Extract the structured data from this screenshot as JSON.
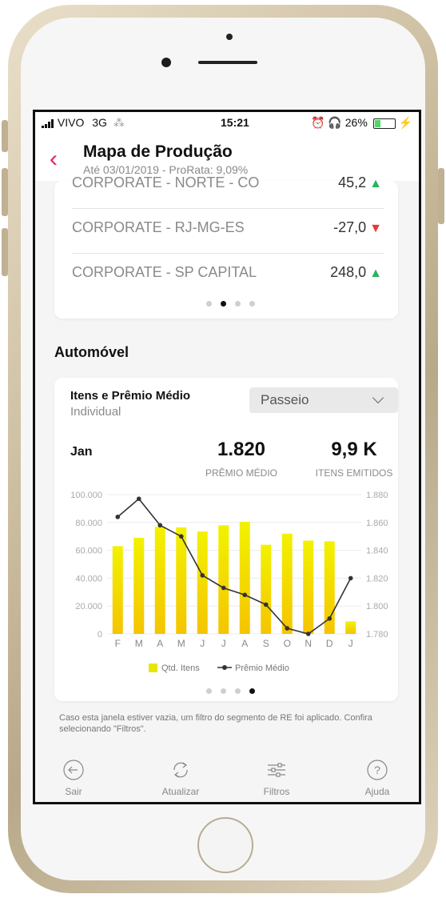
{
  "status_bar": {
    "carrier": "VIVO",
    "network": "3G",
    "time": "15:21",
    "battery": "26%"
  },
  "header": {
    "title": "Mapa de Produção",
    "subtitle": "Até 03/01/2019 - ProRata: 9,09%"
  },
  "regions": [
    {
      "label": "CORPORATE - NORTE - CO",
      "value": "45,2",
      "trend": "up"
    },
    {
      "label": "CORPORATE - RJ-MG-ES",
      "value": "-27,0",
      "trend": "down"
    },
    {
      "label": "CORPORATE - SP CAPITAL",
      "value": "248,0",
      "trend": "up"
    }
  ],
  "section_title": "Automóvel",
  "card": {
    "title": "Itens e Prêmio Médio",
    "subtitle": "Individual",
    "dropdown": "Passeio",
    "month": "Jan",
    "kpi1_value": "1.820",
    "kpi1_label": "PRÊMIO MÉDIO",
    "kpi2_value": "9,9 K",
    "kpi2_label": "ITENS EMITIDOS"
  },
  "chart_data": {
    "type": "bar",
    "categories": [
      "F",
      "M",
      "A",
      "M",
      "J",
      "J",
      "A",
      "S",
      "O",
      "N",
      "D",
      "J"
    ],
    "series": [
      {
        "name": "Qtd. Itens",
        "type": "bar",
        "axis": "left",
        "color": "#e6e600",
        "values": [
          63000,
          69000,
          77000,
          76500,
          73500,
          78000,
          80500,
          64000,
          72000,
          67000,
          66500,
          9000
        ]
      },
      {
        "name": "Prêmio Médio",
        "type": "line",
        "axis": "right",
        "color": "#333333",
        "values": [
          1864,
          1877,
          1858,
          1850,
          1822,
          1813,
          1808,
          1801,
          1784,
          1780,
          1791,
          1820
        ]
      }
    ],
    "y_left_ticks": [
      "100.000",
      "80.000",
      "60.000",
      "40.000",
      "20.000",
      "0"
    ],
    "y_left_range": [
      0,
      100000
    ],
    "y_right_ticks": [
      "1.880",
      "1.860",
      "1.840",
      "1.820",
      "1.800",
      "1.780"
    ],
    "y_right_range": [
      1780,
      1880
    ],
    "legend_placement": "bottom",
    "grid": true
  },
  "pager1": {
    "count": 4,
    "active": 1
  },
  "pager2": {
    "count": 4,
    "active": 3
  },
  "footnote": "Caso esta janela estiver vazia, um filtro do segmento de RE foi aplicado. Confira selecionando \"Filtros\".",
  "tabs": [
    {
      "label": "Sair",
      "icon": "exit-icon"
    },
    {
      "label": "Atualizar",
      "icon": "refresh-icon"
    },
    {
      "label": "Filtros",
      "icon": "filter-icon"
    },
    {
      "label": "Ajuda",
      "icon": "help-icon"
    }
  ],
  "colors": {
    "accent": "#e0245e",
    "up": "#28b463",
    "down": "#e53935",
    "bar": "#e6e600"
  }
}
